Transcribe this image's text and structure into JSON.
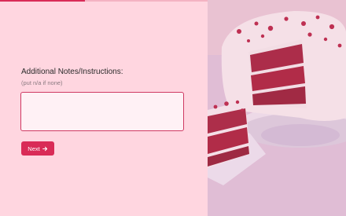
{
  "form": {
    "progress_fraction": 0.41,
    "question_label": "Additional Notes/Instructions:",
    "question_hint": "(put n/a if none)",
    "notes_value": "",
    "next_label": "Next",
    "next_icon": "arrow-right-icon"
  },
  "image": {
    "subject": "red-velvet-cake-photo",
    "colors": {
      "cake_red": "#a3122e",
      "frosting": "#f7eef1",
      "background": "#ddc0dc"
    }
  },
  "colors": {
    "accent": "#d92b57",
    "panel_background": "#ffd6e0"
  }
}
